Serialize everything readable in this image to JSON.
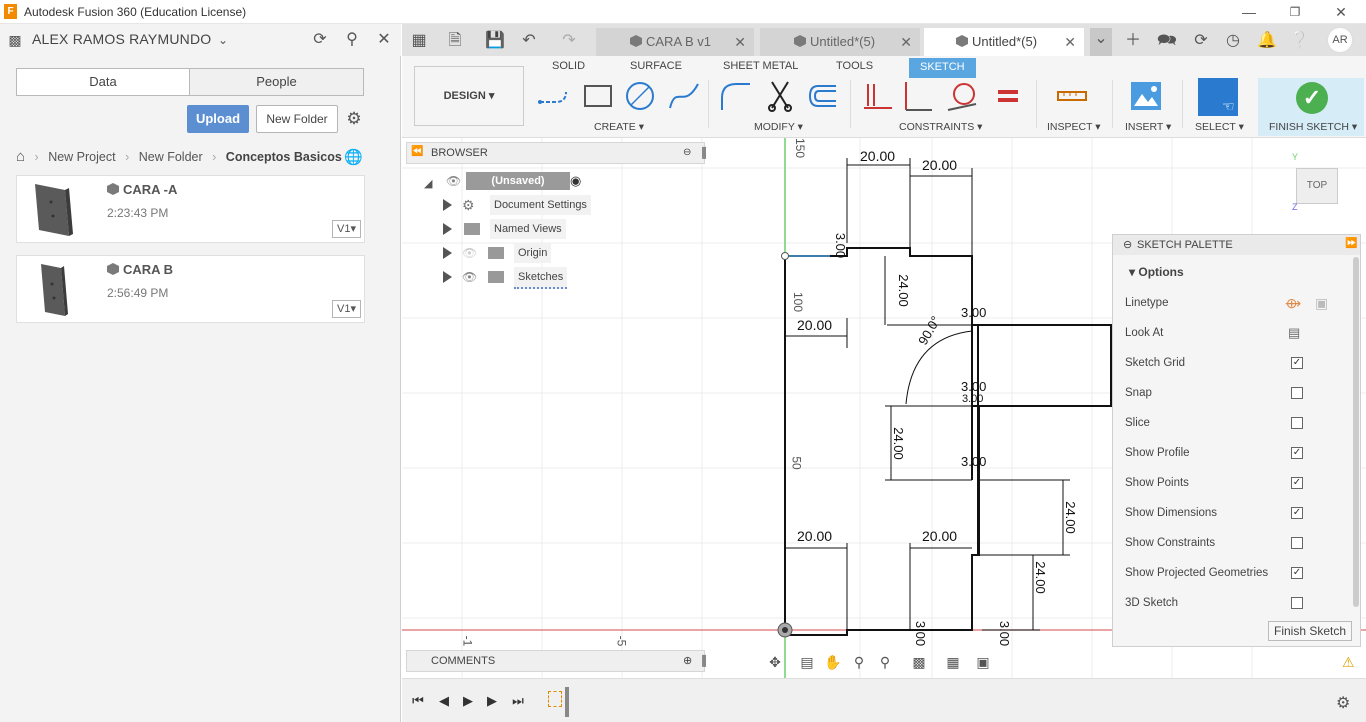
{
  "window": {
    "title": "Autodesk Fusion 360 (Education License)",
    "logo": "F"
  },
  "data_panel": {
    "user": "ALEX RAMOS RAYMUNDO",
    "tabs": [
      "Data",
      "People"
    ],
    "upload_label": "Upload",
    "new_folder_label": "New Folder",
    "breadcrumb": [
      "New Project",
      "New Folder",
      "Conceptos Basicos"
    ],
    "files": [
      {
        "name": "CARA -A",
        "time": "2:23:43 PM",
        "version": "V1"
      },
      {
        "name": "CARA B",
        "time": "2:56:49 PM",
        "version": "V1"
      }
    ]
  },
  "doc_tabs": [
    {
      "label": "CARA B v1"
    },
    {
      "label": "Untitled*(5)"
    },
    {
      "label": "Untitled*(5)"
    }
  ],
  "user_initials": "AR",
  "ribbon": {
    "workspace": "DESIGN",
    "tabs": [
      "SOLID",
      "SURFACE",
      "SHEET METAL",
      "TOOLS",
      "SKETCH"
    ],
    "groups": [
      "CREATE",
      "MODIFY",
      "CONSTRAINTS",
      "INSPECT",
      "INSERT",
      "SELECT",
      "FINISH SKETCH"
    ]
  },
  "browser": {
    "title": "BROWSER",
    "root": "(Unsaved)",
    "items": [
      "Document Settings",
      "Named Views",
      "Origin",
      "Sketches"
    ]
  },
  "comments_label": "COMMENTS",
  "viewcube": {
    "label": "TOP",
    "axis_y": "Y",
    "axis_z": "Z"
  },
  "palette": {
    "title": "SKETCH PALETTE",
    "section": "Options",
    "rows": [
      {
        "label": "Linetype",
        "type": "icons"
      },
      {
        "label": "Look At",
        "type": "icon"
      },
      {
        "label": "Sketch Grid",
        "checked": true
      },
      {
        "label": "Snap",
        "checked": false
      },
      {
        "label": "Slice",
        "checked": false
      },
      {
        "label": "Show Profile",
        "checked": true
      },
      {
        "label": "Show Points",
        "checked": true
      },
      {
        "label": "Show Dimensions",
        "checked": true
      },
      {
        "label": "Show Constraints",
        "checked": false
      },
      {
        "label": "Show Projected Geometries",
        "checked": true
      },
      {
        "label": "3D Sketch",
        "checked": false
      }
    ],
    "finish_label": "Finish Sketch"
  },
  "sketch": {
    "ruler_labels": [
      "150",
      "100",
      "50",
      "-1",
      "-5"
    ],
    "dimensions": [
      "20.00",
      "20.00",
      "3.00",
      "24.00",
      "20.00",
      "90.0°",
      "3.00",
      "3.00",
      "3.00",
      "24.00",
      "3.00",
      "24.00",
      "20.00",
      "20.00",
      "24.00",
      "3.00",
      "3.00"
    ]
  },
  "colors": {
    "accent": "#5aa6e0",
    "finish_green": "#4caf50",
    "upload_blue": "#5b8fd2"
  }
}
